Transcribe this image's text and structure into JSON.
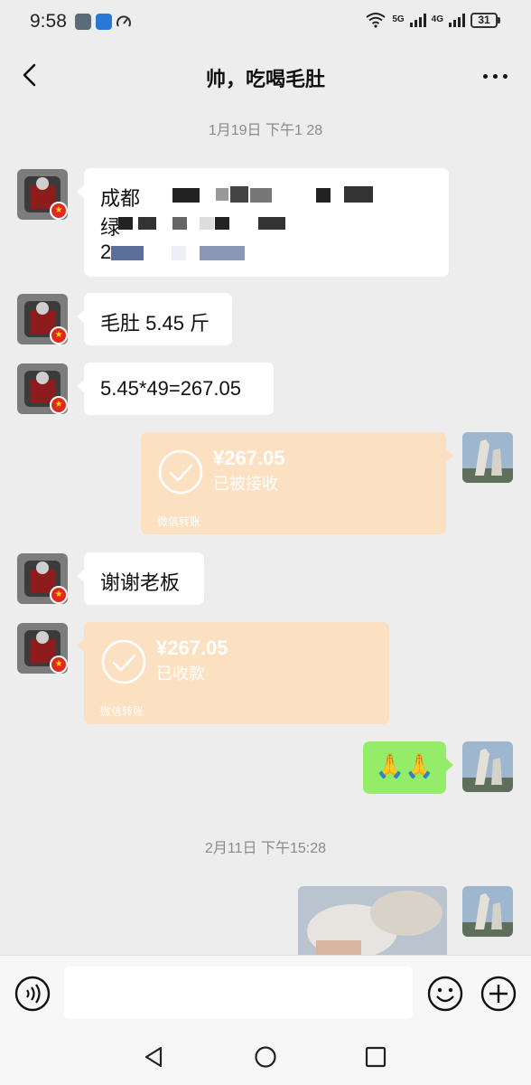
{
  "status_bar": {
    "time": "9:58",
    "net1": "5G",
    "net2": "4G",
    "battery": "31"
  },
  "header": {
    "title": "帅，吃喝毛肚"
  },
  "messages": {
    "timestamp1": "1月19日 下午1 28",
    "address_line1": "成都",
    "address_line2": "绿",
    "address_line3": "2",
    "msg_weight": "毛肚 5.45 斤",
    "msg_calc": "5.45*49=267.05",
    "transfer_sent": {
      "amount": "¥267.05",
      "status": "已被接收",
      "footer": "微信转账"
    },
    "msg_thanks": "谢谢老板",
    "transfer_received": {
      "amount": "¥267.05",
      "status": "已收款",
      "footer": "微信转账"
    },
    "emoji_reply": "🙏🙏",
    "timestamp2": "2月11日 下午15:28"
  },
  "input": {
    "placeholder": ""
  },
  "colors": {
    "background": "#ededed",
    "bubble_white": "#ffffff",
    "bubble_green": "#95ec69",
    "transfer": "#fbe0c2"
  },
  "icons": {
    "back": "back-arrow-icon",
    "more": "more-icon",
    "voice": "voice-icon",
    "emoji": "emoji-icon",
    "plus": "plus-icon"
  }
}
